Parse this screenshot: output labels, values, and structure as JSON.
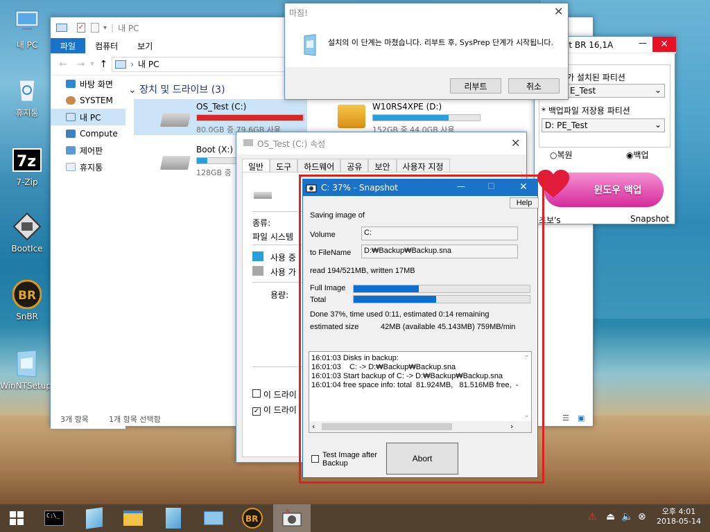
{
  "colors": {
    "accent": "#1a73c9",
    "progress": "#26a0da",
    "snap_progress": "#0b6fcf",
    "highlight_border": "#e02020",
    "pink_button": "#e84bb0"
  },
  "desktop": {
    "icons": [
      {
        "label": "내 PC",
        "icon": "computer-icon"
      },
      {
        "label": "휴지통",
        "icon": "recycle-bin-icon"
      },
      {
        "label": "7-Zip",
        "icon": "7zip-icon"
      },
      {
        "label": "BootIce",
        "icon": "bootice-icon"
      },
      {
        "label": "SnBR",
        "icon": "snbr-icon"
      },
      {
        "label": "WinNTSetup:",
        "icon": "winntsetup-icon"
      }
    ]
  },
  "explorer": {
    "title": "내 PC",
    "ribbon_tabs": [
      "파일",
      "컴퓨터",
      "보기"
    ],
    "address": "내 PC",
    "sidebar": [
      "바탕 화면",
      "SYSTEM",
      "내 PC",
      "Compute",
      "제어판",
      "휴지통"
    ],
    "section": "장치 및 드라이브 (3)",
    "drives": [
      {
        "name": "OS_Test (C:)",
        "info": "80.0GB 중 79.6GB 사용",
        "fill": 0.995
      },
      {
        "name": "W10RS4XPE (D:)",
        "info": "152GB 중 44.0GB 사용",
        "fill": 0.71
      },
      {
        "name": "Boot (X:)",
        "info": "128GB 중",
        "fill": 0.1
      }
    ],
    "status_count": "3개 항목",
    "status_selected": "1개 항목 선택함"
  },
  "done_dialog": {
    "title": "마침!",
    "message": "설치의 이 단계는 마쳤습니다.  리부트 후, SysPrep 단계가 시작됩니다.",
    "reboot": "리부트",
    "cancel": "취소"
  },
  "props": {
    "title": "OS_Test (C:) 속성",
    "tabs": [
      "일반",
      "도구",
      "하드웨어",
      "공유",
      "보안",
      "사용자 지정"
    ],
    "type_label": "종류:",
    "fs_label": "파일 시스템",
    "used_label": "사용 중",
    "free_label": "사용 가",
    "capacity_label": "용량:",
    "check1": "이 드라이",
    "check2": "이 드라이"
  },
  "br": {
    "title": "ot BR 16,1A",
    "label1": "가 설치된 파티션",
    "part1": "E_Test",
    "label2": "* 백업파일 저장용 파티션",
    "part2": "D: PE_Test",
    "restore": "복원",
    "backup": "백업",
    "big_button": "윈도우 백업",
    "author": "초보's",
    "snapshot": "Snapshot"
  },
  "snapshot": {
    "title": "C: 37%  -  Snapshot",
    "help": "Help",
    "saving": "Saving image of",
    "volume_label": "Volume",
    "volume": "C:",
    "file_label": "to FileName",
    "file": "D:₩Backup₩Backup.sna",
    "read": "read 194/521MB, written 17MB",
    "full_label": "Full Image",
    "full_progress": 0.37,
    "total_label": "Total",
    "total_progress": 0.47,
    "done": "Done 37%, time used  0:11, estimated 0:14 remaining",
    "est_label": "estimated size",
    "est_value": "42MB (available   45.143MB) 759MB/min",
    "log": [
      "16:01:03 Disks in backup:",
      "16:01:03    C: -> D:₩Backup₩Backup.sna",
      "16:01:03 Start backup of C: -> D:₩Backup₩Backup.sna",
      "16:01:04 free space info: total  81.924MB,   81.516MB free,  -"
    ],
    "test_label": "Test Image after Backup",
    "abort": "Abort"
  },
  "taskbar": {
    "time": "오후 4:01",
    "date": "2018-05-14"
  }
}
